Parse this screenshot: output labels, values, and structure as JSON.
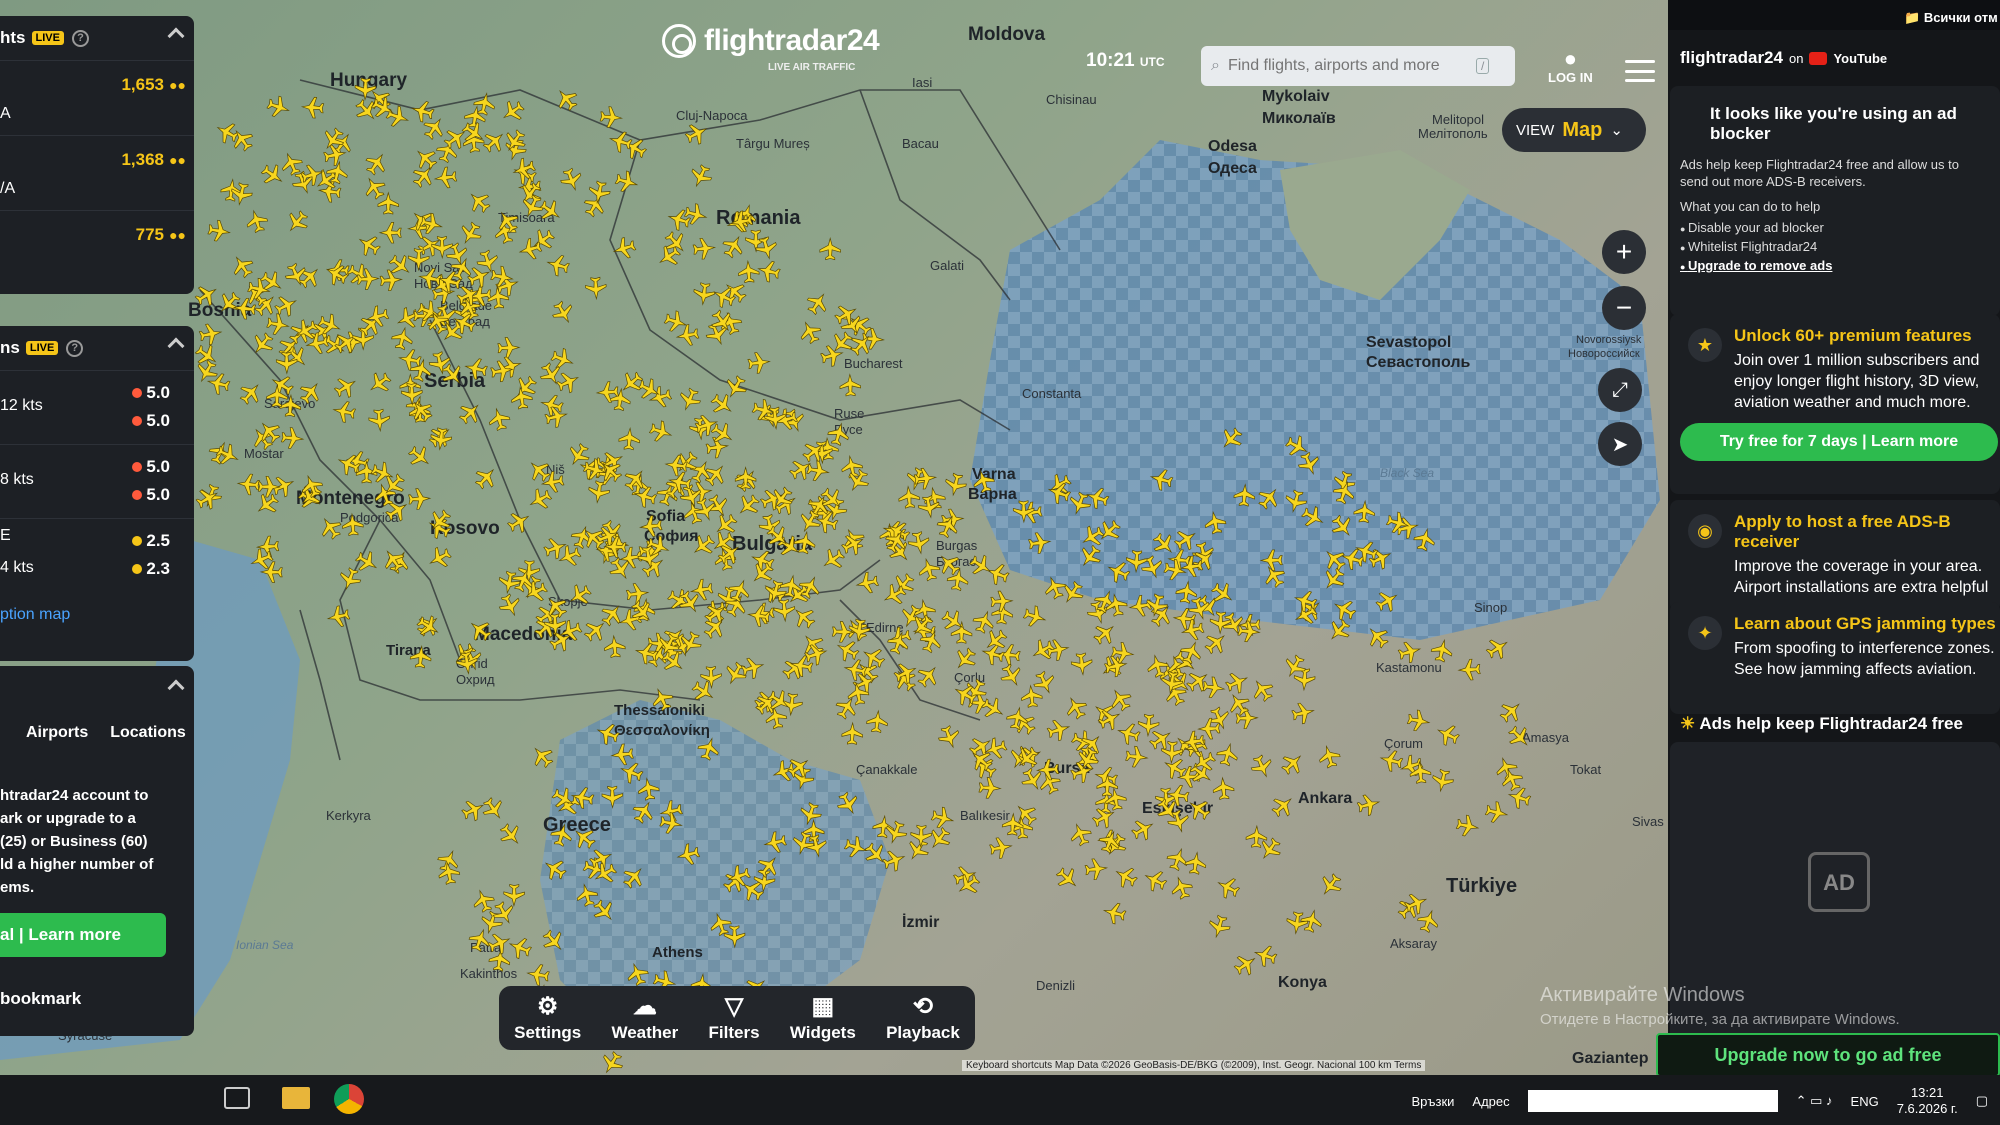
{
  "app": {
    "logo_name": "flightradar24",
    "logo_sub": "LIVE AIR TRAFFIC",
    "time": "10:21",
    "time_zone": "UTC",
    "search_placeholder": "Find flights, airports and more",
    "search_shortcut": "/",
    "login_label": "LOG IN",
    "view_label": "VIEW",
    "view_value": "Map"
  },
  "top_right_folder": "Всички отм",
  "left_panel": {
    "flights_title": "hts",
    "live_badge": "LIVE",
    "flights_rows": [
      {
        "value": "1,653",
        "sub": "A"
      },
      {
        "value": "1,368",
        "sub": "/A"
      },
      {
        "value": "775",
        "sub": ""
      }
    ],
    "weather_title": "ns",
    "weather_rows": [
      {
        "label": "12 kts",
        "a": "5.0",
        "b": "5.0"
      },
      {
        "label": "8 kts",
        "a": "5.0",
        "b": "5.0"
      },
      {
        "label": "4 kts",
        "a": "2.5",
        "b": "2.3",
        "prefix": "E"
      }
    ],
    "option_map_link": "ption map",
    "tabs": [
      "Airports",
      "Locations"
    ],
    "promo_text": [
      "htradar24 account to",
      "ark or upgrade to a",
      "(25) or Business (60)",
      "ld a higher number of",
      "ems."
    ],
    "promo_button": "al | Learn more",
    "bookmark_label": "bookmark"
  },
  "map": {
    "countries": [
      "Romania",
      "Bulgaria",
      "Greece",
      "Türkiye",
      "Serbia",
      "Macedonia",
      "Bosnia",
      "Moldova",
      "Hungary",
      "Montenegro",
      "Kosovo"
    ],
    "cities": [
      "Cluj-Napoca",
      "Târgu Mureș",
      "Iasi",
      "Bacau",
      "Chisinau",
      "Mykolaiv",
      "Миколаїв",
      "Odesa",
      "Одеса",
      "Melitopol",
      "Мелітополь",
      "Timisoara",
      "Galati",
      "Constanta",
      "Bucharest",
      "Ruse",
      "Русе",
      "Varna",
      "Варна",
      "Burgas",
      "Бургас",
      "Sofia",
      "София",
      "Niš",
      "Belgrade",
      "Београд",
      "Novi Sad",
      "Нови Сад",
      "Sevastopol",
      "Севастополь",
      "Novorossiysk",
      "Новороссийск",
      "Black Sea",
      "Sinop",
      "Kastamonu",
      "Çorum",
      "Amasya",
      "Tokat",
      "Sivas",
      "Ankara",
      "Eskişehir",
      "Bursa",
      "Balıkesir",
      "Çanakkale",
      "Edirne",
      "Çorlu",
      "Thessaloniki",
      "Θεσσαλονίκη",
      "Tirana",
      "Ohrid",
      "Охрид",
      "Skopje",
      "İzmir",
      "Denizli",
      "Aksaray",
      "Konya",
      "Gaziantep",
      "Sarajevo",
      "Mostar",
      "Podgorica",
      "Patra",
      "Athens",
      "Kerkyra",
      "Ionian Sea",
      "Syracuse",
      "Kakinthos"
    ],
    "attribution": "Keyboard shortcuts   Map Data ©2026 GeoBasis-DE/BKG (©2009), Inst. Geogr. Nacional   100 km   Terms"
  },
  "toolbar": [
    {
      "label": "Settings",
      "icon": "gear-icon"
    },
    {
      "label": "Weather",
      "icon": "weather-icon"
    },
    {
      "label": "Filters",
      "icon": "filter-icon"
    },
    {
      "label": "Widgets",
      "icon": "widgets-icon"
    },
    {
      "label": "Playback",
      "icon": "playback-icon"
    }
  ],
  "right_panel": {
    "yt_title": "flightradar24",
    "yt_on": "on",
    "yt_brand": "YouTube",
    "adblock_title": "It looks like you're using an ad blocker",
    "adblock_text": "Ads help keep Flightradar24 free and allow us to send out more ADS-B receivers.",
    "adblock_what": "What you can do to help",
    "adblock_items": [
      "Disable your ad blocker",
      "Whitelist Flightradar24",
      "Upgrade to remove ads"
    ],
    "features": [
      {
        "title": "Unlock 60+ premium features",
        "text": "Join over 1 million subscribers and enjoy longer flight history, 3D view, aviation weather and much more.",
        "button": "Try free for 7 days | Learn more"
      },
      {
        "title": "Apply to host a free ADS-B receiver",
        "text": "Improve the coverage in your area. Airport installations are extra helpful"
      },
      {
        "title": "Learn about GPS jamming types",
        "text": "From spoofing to interference zones. See how jamming affects aviation."
      }
    ],
    "ads_note": "Ads help keep Flightradar24 free",
    "ad_label": "AD",
    "upgrade_button": "Upgrade now to go ad free",
    "watermark_title": "Активирайте Windows",
    "watermark_sub": "Отидете в Настройките, за да активирате Windows."
  },
  "taskbar": {
    "links": "Връзки",
    "address": "Адрес",
    "lang": "ENG",
    "time": "13:21",
    "date": "7.6.2026 г."
  }
}
